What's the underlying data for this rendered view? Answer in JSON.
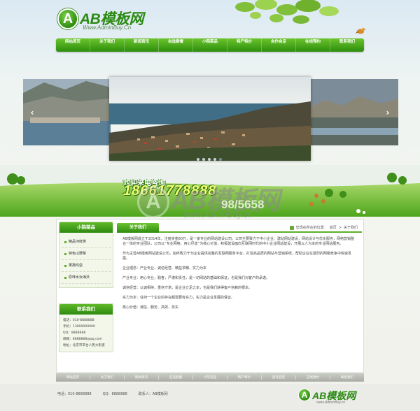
{
  "header": {
    "logo_mark": "A",
    "logo_name": "AB模板网",
    "logo_url": "Www.AdminBuy.Cn"
  },
  "nav": {
    "items": [
      "网站首页",
      "关于我们",
      "新闻资讯",
      "自选套餐",
      "小院菜品",
      "特产特价",
      "自作自足",
      "在线预约",
      "联系我们"
    ]
  },
  "slider": {
    "prev": "‹",
    "next": "›",
    "dots": 5,
    "active_dot": 4
  },
  "banner": {
    "hotline_label": "欢迎来电咨询",
    "hotline_number": "18661778888",
    "phone_partial": "98/5658",
    "watermark_mark": "A",
    "watermark_name": "AB模板网",
    "watermark_url": "www.AdminBuy.cn"
  },
  "sidebar": {
    "products_title": "小院菜品",
    "products": [
      "精品河鲜类",
      "特色山野菜",
      "果蔬鸡蛋",
      "原味水汝海沃"
    ],
    "contact_title": "联系我们",
    "contact_lines": [
      "电话：010-8888888",
      "手机：13900000000",
      "QQ：8888888",
      "邮箱：8888888@qq.com",
      "地址：北京市丰台人民大街道"
    ]
  },
  "main": {
    "tab_label": "关于我们",
    "breadcrumb_prefix": "您现在所在的位置：",
    "breadcrumb_home": "首页",
    "breadcrumb_sep": ">",
    "breadcrumb_current": "关于我们",
    "paragraphs": [
      "AB模板网成立于2014年，注册资金80万，是一家专业的网站建设公司。公司主要致力于中小企业、建站网站建设，网站设计与优化服务，网络营销整合一体的专业团队，公司以“专业网络，用心尽善”为核心价值，积极建设面向互联网时代的中小企业网站建设，开展以人为本的专业网站服务。",
      "作为主营AB模板网站建设公司，始终致力于为企业提供完整的互联网服务平台，打造高品质的网站与营销系统，帮助企业在激烈的网络竞争中快速发展。",
      "企业理念：产业专业、诚信经营、精益求精、实力为本",
      "产业专业：用心专业，勤奋，严谨和责任，是一切网站的基础和保证，也是我们对客户的承诺。",
      "诚信经营：以诚相待，重信守诺，是企业立足之本，也是我们获得客户信赖的根本。",
      "实力为本：任何一个企业的存在都需要有实力，实力是企业发展的保证。",
      "核心价值：诚信、服务、高效、务实"
    ]
  },
  "footer": {
    "links": [
      "网站首页",
      "关于我们",
      "新闻资讯",
      "自选套餐",
      "小院菜品",
      "特产特价",
      "自作自足",
      "在线预约",
      "联系我们"
    ],
    "phone": "电话：010-8888888",
    "qq": "QQ：8888888",
    "contact": "联系人：AB模板网",
    "logo_mark": "A",
    "logo_name": "AB模板网",
    "logo_url": "www.AdminBuy.cn"
  }
}
